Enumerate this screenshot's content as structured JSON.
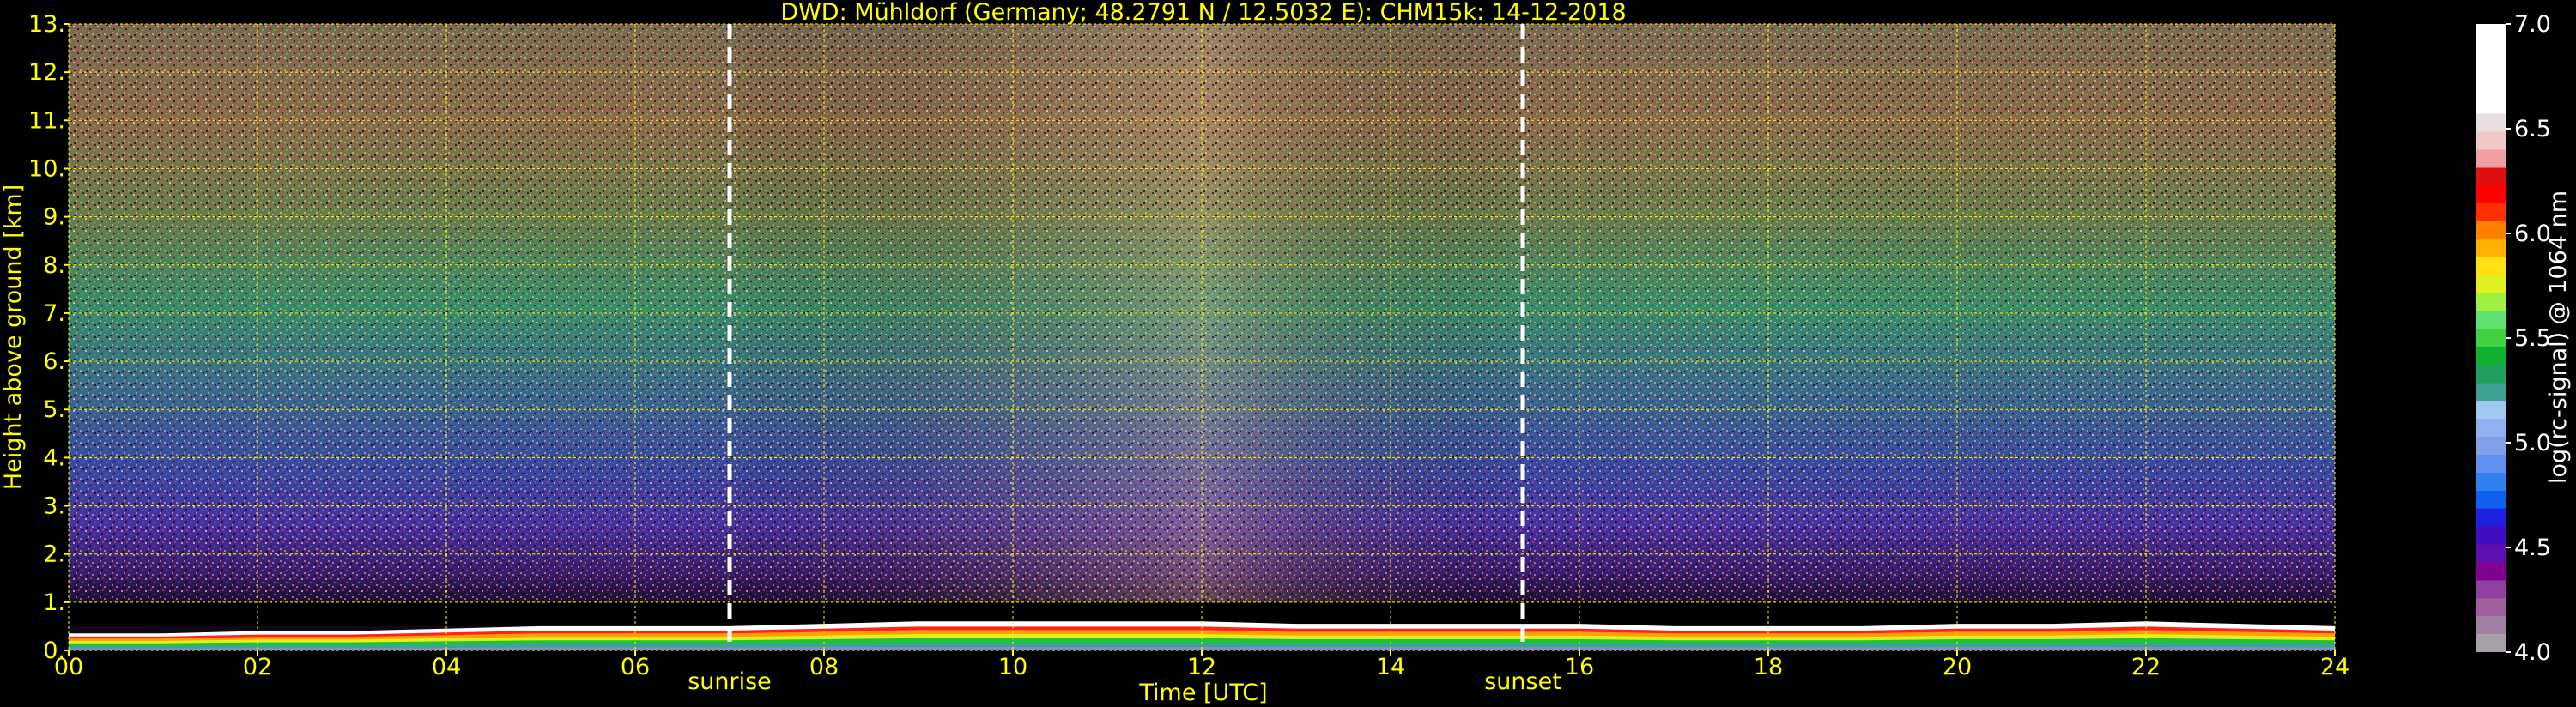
{
  "chart_data": {
    "type": "heatmap",
    "title": "DWD: Mühldorf (Germany; 48.2791 N / 12.5032 E):    CHM15k: 14-12-2018",
    "xlabel": "Time [UTC]",
    "ylabel": "Height above ground [km]",
    "xlim": [
      0,
      24
    ],
    "ylim": [
      0,
      13
    ],
    "x_ticks": [
      0,
      2,
      4,
      6,
      8,
      10,
      12,
      14,
      16,
      18,
      20,
      22,
      24
    ],
    "x_tick_labels": [
      "00",
      "02",
      "04",
      "06",
      "08",
      "10",
      "12",
      "14",
      "16",
      "18",
      "20",
      "22",
      "24"
    ],
    "y_ticks": [
      0,
      1,
      2,
      3,
      4,
      5,
      6,
      7,
      8,
      9,
      10,
      11,
      12,
      13
    ],
    "y_tick_labels": [
      "0.",
      "1.",
      "2.",
      "3.",
      "4.",
      "5.",
      "6.",
      "7.",
      "8.",
      "9.",
      "10.",
      "11.",
      "12.",
      "13."
    ],
    "grid": true,
    "grid_color": "#ffff00",
    "events": [
      {
        "label": "sunrise",
        "time": 7.0
      },
      {
        "label": "sunset",
        "time": 15.4
      }
    ],
    "colorbar": {
      "label": "log(rc-signal) @ 1064 nm",
      "range": [
        4.0,
        7.0
      ],
      "ticks": [
        4.0,
        4.5,
        5.0,
        5.5,
        6.0,
        6.5,
        7.0
      ],
      "tick_labels": [
        "4.0",
        "4.5",
        "5.0",
        "5.5",
        "6.0",
        "6.5",
        "7.0"
      ],
      "colors": [
        "#a8a0a8",
        "#a080a0",
        "#a060a0",
        "#9040a0",
        "#800090",
        "#6010b0",
        "#4010c0",
        "#2020e0",
        "#1060f0",
        "#3080f0",
        "#6090f0",
        "#80a0e8",
        "#90b0f0",
        "#a0c8f0",
        "#40a090",
        "#20a060",
        "#10b030",
        "#40d040",
        "#60e070",
        "#a0f040",
        "#e0f020",
        "#ffe010",
        "#ffb000",
        "#ff8000",
        "#ff3000",
        "#ff0000",
        "#e01010",
        "#f0a0a0",
        "#f0c8c8",
        "#e8e0e0",
        "#ffffff",
        "#ffffff",
        "#ffffff",
        "#ffffff",
        "#ffffff"
      ]
    },
    "boundary_layer_top_km": [
      0.35,
      0.35,
      0.4,
      0.4,
      0.45,
      0.5,
      0.5,
      0.5,
      0.55,
      0.6,
      0.6,
      0.6,
      0.6,
      0.55,
      0.55,
      0.55,
      0.55,
      0.5,
      0.5,
      0.5,
      0.55,
      0.55,
      0.6,
      0.55,
      0.5
    ],
    "noise_fade_height_km": 1.0
  }
}
